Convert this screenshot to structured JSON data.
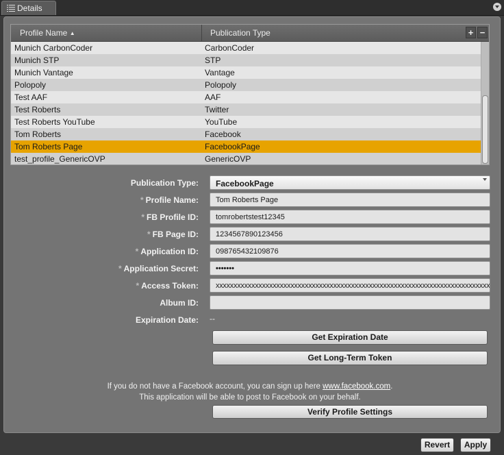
{
  "tab": {
    "title": "Details"
  },
  "table": {
    "columns": [
      "Profile Name",
      "Publication Type"
    ],
    "add_label": "+",
    "remove_label": "−",
    "rows": [
      {
        "name": "Munich CarbonCoder",
        "type": "CarbonCoder"
      },
      {
        "name": "Munich STP",
        "type": "STP"
      },
      {
        "name": "Munich Vantage",
        "type": "Vantage"
      },
      {
        "name": "Polopoly",
        "type": "Polopoly"
      },
      {
        "name": "Test AAF",
        "type": "AAF"
      },
      {
        "name": "Test Roberts",
        "type": "Twitter"
      },
      {
        "name": "Test Roberts YouTube",
        "type": "YouTube"
      },
      {
        "name": "Tom Roberts",
        "type": "Facebook"
      },
      {
        "name": "Tom Roberts Page",
        "type": "FacebookPage",
        "selected": true
      },
      {
        "name": "test_profile_GenericOVP",
        "type": "GenericOVP"
      }
    ]
  },
  "form": {
    "publication_type_label": "Publication Type:",
    "publication_type_value": "FacebookPage",
    "profile_name_label": "Profile Name:",
    "profile_name_value": "Tom Roberts Page",
    "fb_profile_id_label": "FB Profile ID:",
    "fb_profile_id_value": "tomrobertstest12345",
    "fb_page_id_label": "FB Page ID:",
    "fb_page_id_value": "1234567890123456",
    "application_id_label": "Application ID:",
    "application_id_value": "098765432109876",
    "application_secret_label": "Application Secret:",
    "application_secret_value": "•••••••",
    "access_token_label": "Access Token:",
    "access_token_value": "xxxxxxxxxxxxxxxxxxxxxxxxxxxxxxxxxxxxxxxxxxxxxxxxxxxxxxxxxxxxxxxxxxxxxxxxxxxxxxxx",
    "album_id_label": "Album ID:",
    "album_id_value": "",
    "expiration_date_label": "Expiration Date:",
    "expiration_date_value": "--",
    "required_marker": "*"
  },
  "buttons": {
    "get_expiration_date": "Get Expiration Date",
    "get_long_term_token": "Get Long-Term Token",
    "verify_profile_settings": "Verify Profile Settings",
    "revert": "Revert",
    "apply": "Apply"
  },
  "info": {
    "line1_prefix": "If you do not have a Facebook account, you can sign up here ",
    "line1_link": "www.facebook.com",
    "line1_suffix": ".",
    "line2": "This application will be able to post to Facebook on your behalf."
  },
  "colors": {
    "selected_row": "#e7a300",
    "panel": "#747474",
    "background": "#3a3a3a"
  }
}
